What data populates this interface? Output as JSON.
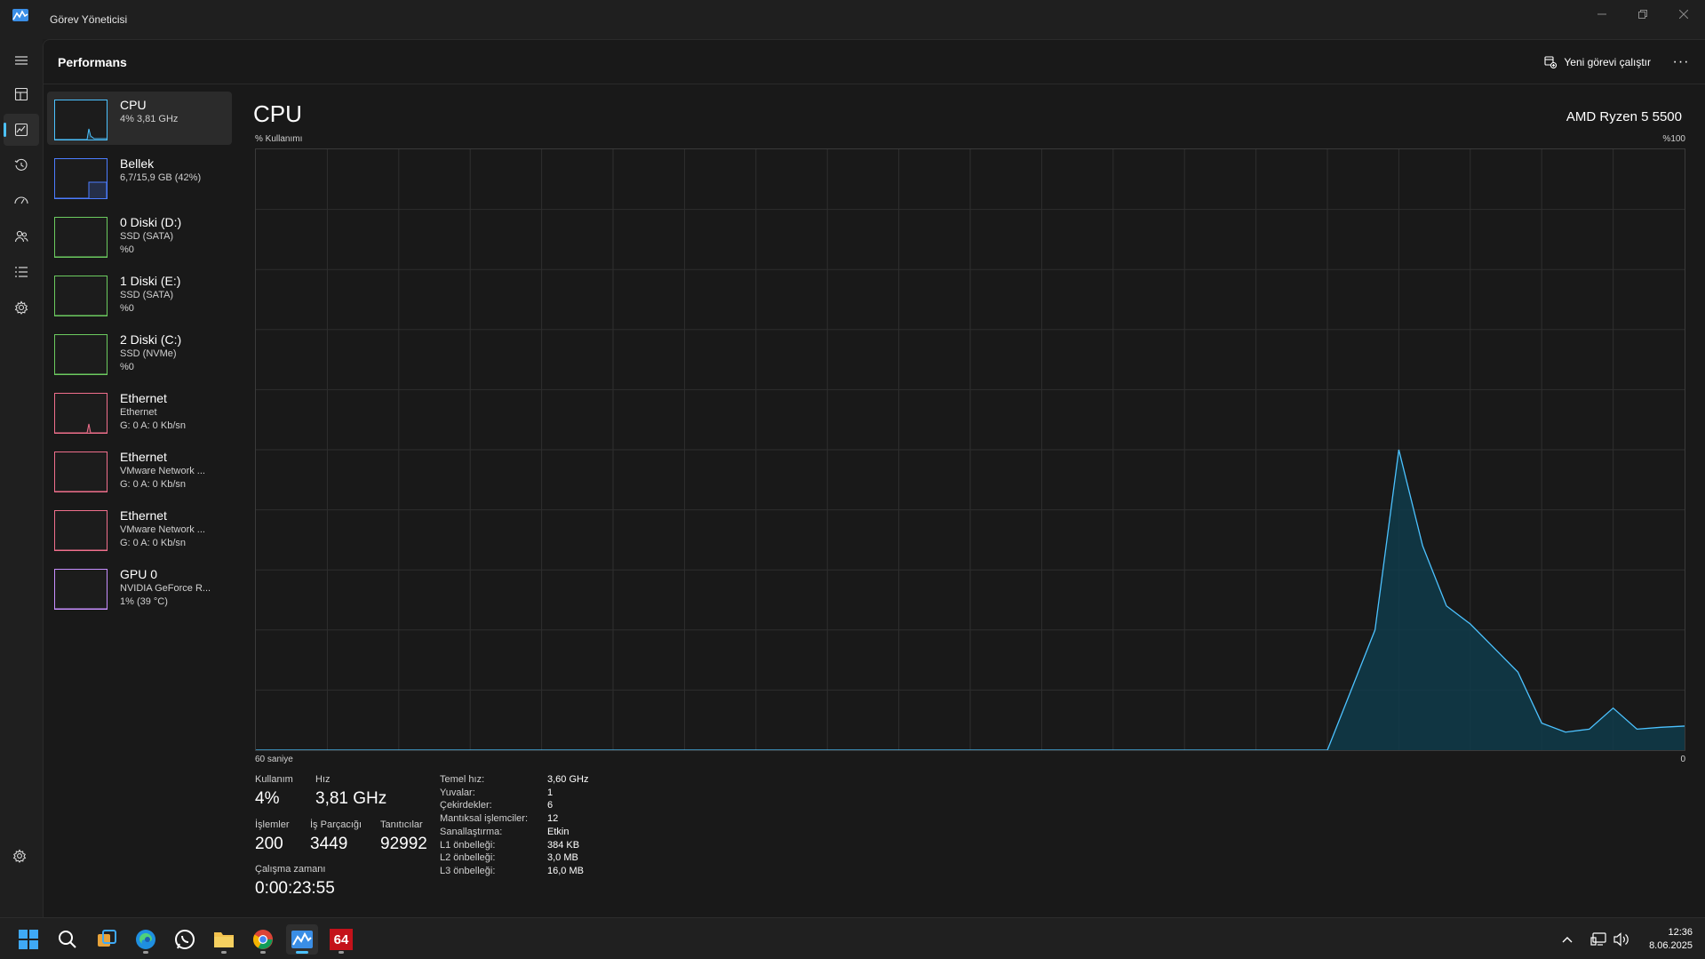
{
  "window": {
    "title": "Görev Yöneticisi",
    "controls": [
      "minimize-icon",
      "restore-icon",
      "close-icon"
    ]
  },
  "nav": {
    "items": [
      "hamburger-menu-icon",
      "processes-icon",
      "performance-icon",
      "app-history-icon",
      "startup-apps-icon",
      "users-icon",
      "details-icon",
      "services-icon"
    ],
    "active": "performance-icon",
    "settings": "gear-icon"
  },
  "header": {
    "title": "Performans",
    "run_task_label": "Yeni görevi çalıştır",
    "more_label": "···"
  },
  "devices": [
    {
      "name": "CPU",
      "sub1": "4% 3,81 GHz",
      "sub2": "",
      "color": "#4cc2ff"
    },
    {
      "name": "Bellek",
      "sub1": "6,7/15,9 GB (42%)",
      "sub2": "",
      "color": "#4c7cff"
    },
    {
      "name": "0 Diski (D:)",
      "sub1": "SSD (SATA)",
      "sub2": "%0",
      "color": "#6ccb5f"
    },
    {
      "name": "1 Diski (E:)",
      "sub1": "SSD (SATA)",
      "sub2": "%0",
      "color": "#6ccb5f"
    },
    {
      "name": "2 Diski (C:)",
      "sub1": "SSD (NVMe)",
      "sub2": "%0",
      "color": "#6ccb5f"
    },
    {
      "name": "Ethernet",
      "sub1": "Ethernet",
      "sub2": "G: 0 A: 0 Kb/sn",
      "color": "#f06f8c"
    },
    {
      "name": "Ethernet",
      "sub1": "VMware Network ...",
      "sub2": "G: 0 A: 0 Kb/sn",
      "color": "#f06f8c"
    },
    {
      "name": "Ethernet",
      "sub1": "VMware Network ...",
      "sub2": "G: 0 A: 0 Kb/sn",
      "color": "#f06f8c"
    },
    {
      "name": "GPU 0",
      "sub1": "NVIDIA GeForce R...",
      "sub2": "1% (39 °C)",
      "color": "#c78fff"
    }
  ],
  "cpu": {
    "title": "CPU",
    "model": "AMD Ryzen 5 5500",
    "usage_axis_label": "% Kullanımı",
    "max_label": "%100",
    "time_label": "60 saniye",
    "zero_label": "0",
    "stats": {
      "usage_label": "Kullanım",
      "usage_value": "4%",
      "speed_label": "Hız",
      "speed_value": "3,81 GHz",
      "processes_label": "İşlemler",
      "processes_value": "200",
      "threads_label": "İş Parçacığı",
      "threads_value": "3449",
      "handles_label": "Tanıtıcılar",
      "handles_value": "92992",
      "uptime_label": "Çalışma zamanı",
      "uptime_value": "0:00:23:55"
    },
    "specs": [
      {
        "key": "Temel hız:",
        "value": "3,60 GHz"
      },
      {
        "key": "Yuvalar:",
        "value": "1"
      },
      {
        "key": "Çekirdekler:",
        "value": "6"
      },
      {
        "key": "Mantıksal işlemciler:",
        "value": "12"
      },
      {
        "key": "Sanallaştırma:",
        "value": "Etkin"
      },
      {
        "key": "L1 önbelleği:",
        "value": "384 KB"
      },
      {
        "key": "L2 önbelleği:",
        "value": "3,0 MB"
      },
      {
        "key": "L3 önbelleği:",
        "value": "16,0 MB"
      }
    ]
  },
  "chart_data": {
    "type": "area",
    "xlabel": "60 saniye",
    "ylabel": "% Kullanımı",
    "xlim": [
      60,
      0
    ],
    "ylim": [
      0,
      100
    ],
    "grid": true,
    "x": [
      60,
      15,
      13,
      12,
      11,
      10,
      9,
      8,
      7,
      6,
      5,
      4,
      3,
      2,
      1,
      0
    ],
    "values": [
      0,
      0,
      20,
      50,
      34,
      24,
      21,
      17,
      13,
      4.5,
      3,
      3.5,
      7,
      3.5,
      3.8,
      4
    ],
    "color": "#4cc2ff"
  },
  "taskbar": {
    "apps": [
      {
        "icon": "windows-start-icon",
        "running": false
      },
      {
        "icon": "search-icon",
        "running": false
      },
      {
        "icon": "task-view-icon",
        "running": false
      },
      {
        "icon": "edge-browser-icon",
        "running": true
      },
      {
        "icon": "whatsapp-icon",
        "running": false
      },
      {
        "icon": "file-explorer-icon",
        "running": true
      },
      {
        "icon": "chrome-browser-icon",
        "running": true
      },
      {
        "icon": "task-manager-icon",
        "running": true
      },
      {
        "icon": "aida64-icon",
        "running": true,
        "label": "64"
      }
    ],
    "time": "12:36",
    "date": "8.06.2025"
  }
}
